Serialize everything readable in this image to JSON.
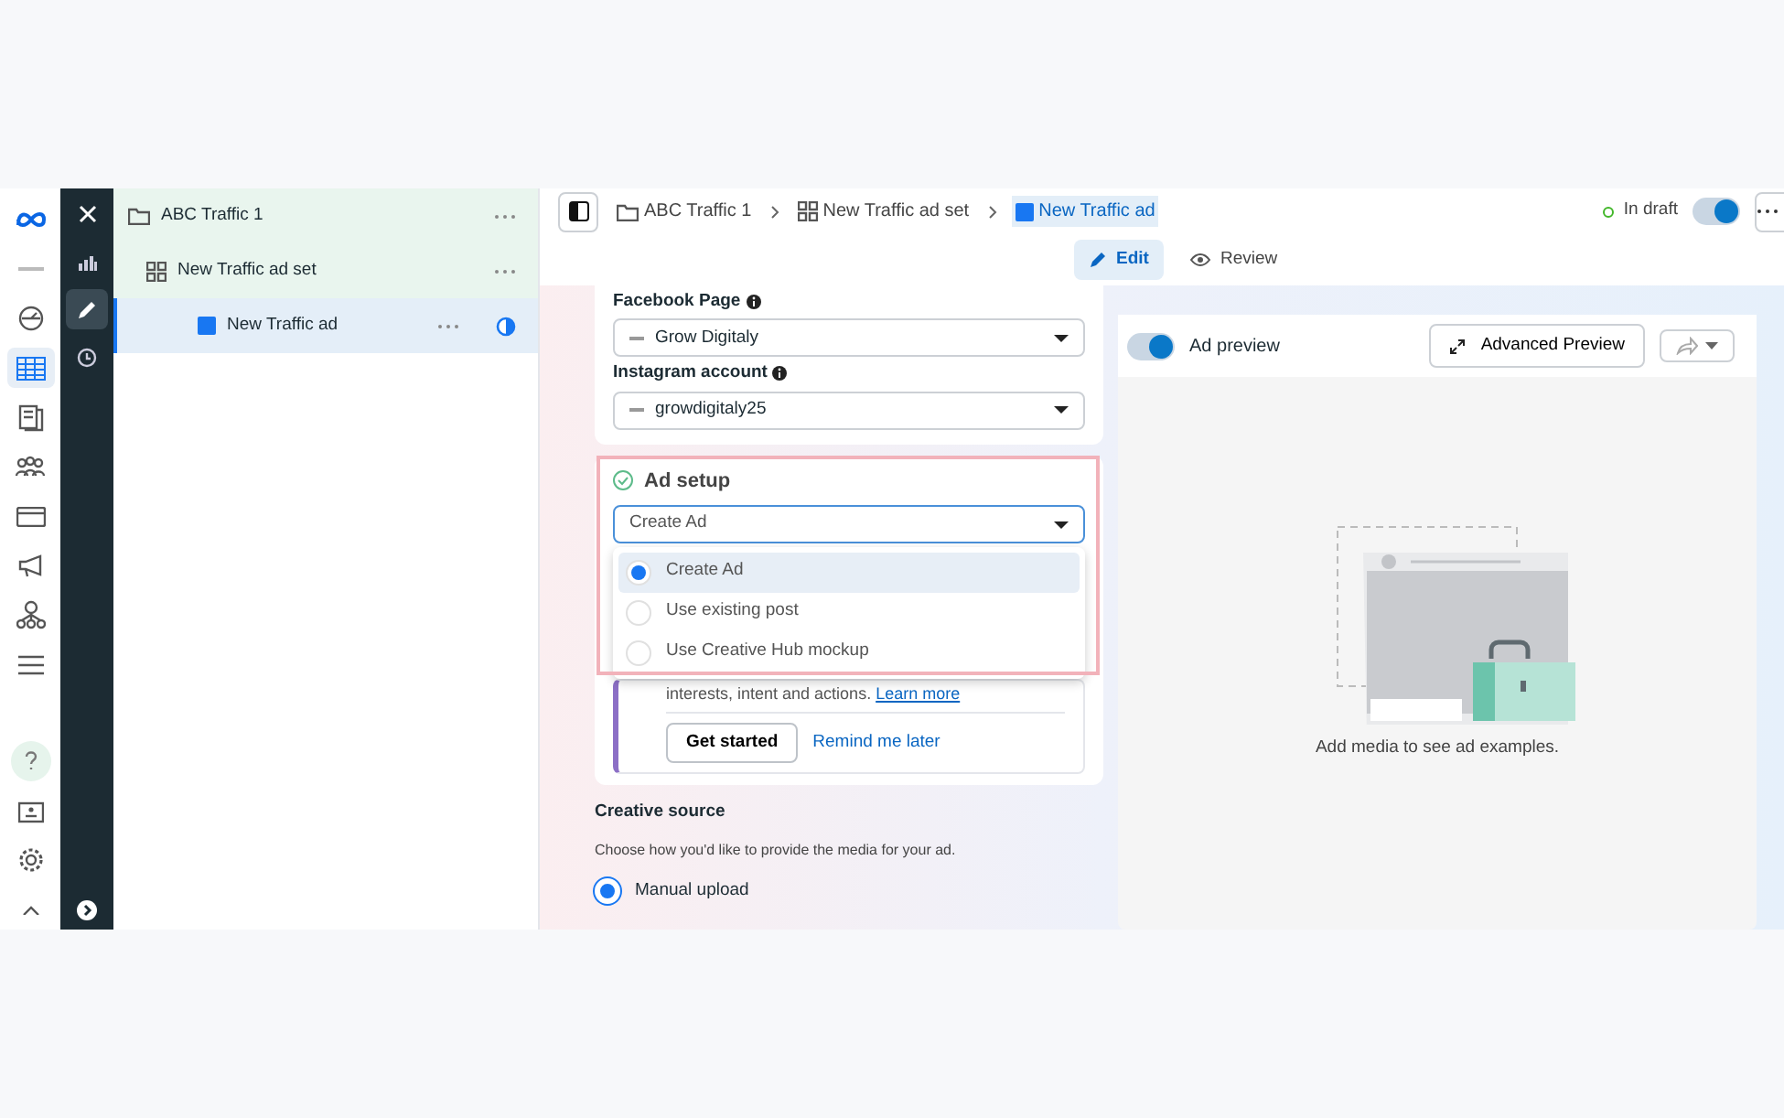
{
  "nav_rail": [
    {
      "kind": "logo",
      "selected": false
    },
    {
      "kind": "account",
      "selected": false
    },
    {
      "kind": "gauge",
      "selected": false
    },
    {
      "kind": "table",
      "selected": true
    },
    {
      "kind": "pages",
      "selected": false
    },
    {
      "kind": "people",
      "selected": false
    },
    {
      "kind": "card",
      "selected": false
    },
    {
      "kind": "megaphone",
      "selected": false
    },
    {
      "kind": "network",
      "selected": false
    },
    {
      "kind": "menu",
      "selected": false
    },
    {
      "kind": "gap"
    },
    {
      "kind": "help",
      "selected": false
    },
    {
      "kind": "contact",
      "selected": false
    },
    {
      "kind": "gear",
      "selected": false
    },
    {
      "kind": "chevron",
      "selected": false
    }
  ],
  "tool_rail": [
    {
      "kind": "close",
      "selected": false
    },
    {
      "kind": "chart",
      "selected": false
    },
    {
      "kind": "pencil",
      "selected": true
    },
    {
      "kind": "clock",
      "selected": false
    },
    {
      "kind": "gap"
    },
    {
      "kind": "expand",
      "selected": false
    }
  ],
  "tree": [
    {
      "kind": "campaign",
      "label": "ABC Traffic 1",
      "selected": false,
      "children": [
        {
          "kind": "adset",
          "label": "New Traffic ad set",
          "selected": false,
          "children": [
            {
              "kind": "ad",
              "label": "New Traffic ad",
              "selected": true
            }
          ]
        }
      ]
    }
  ],
  "breadcrumb": [
    {
      "kind": "campaign",
      "label": "ABC Traffic 1",
      "selected": false
    },
    {
      "kind": "adset",
      "label": "New Traffic ad set",
      "selected": false
    },
    {
      "kind": "ad",
      "label": "New Traffic ad",
      "selected": true
    }
  ],
  "status": {
    "label": "In draft",
    "on": true
  },
  "tabs": [
    {
      "kind": "edit",
      "label": "Edit",
      "selected": true
    },
    {
      "kind": "review",
      "label": "Review",
      "selected": false
    }
  ],
  "identity": {
    "facebook_page": {
      "label": "Facebook Page",
      "value": "Grow Digitaly"
    },
    "instagram_account": {
      "label": "Instagram account",
      "value": "growdigitaly25"
    }
  },
  "ad_setup": {
    "title": "Ad setup",
    "value": "Create Ad",
    "highlighted": true,
    "options": [
      {
        "label": "Create Ad",
        "selected": true
      },
      {
        "label": "Use existing post",
        "selected": false
      },
      {
        "label": "Use Creative Hub mockup",
        "selected": false
      }
    ]
  },
  "notice": {
    "text": "interests, intent and actions.",
    "link": "Learn more",
    "button": "Get started",
    "secondary": "Remind me later"
  },
  "creative_source": {
    "title": "Creative source",
    "description": "Choose how you'd like to provide the media for your ad.",
    "options": [
      {
        "label": "Manual upload",
        "selected": true
      }
    ]
  },
  "preview": {
    "toggle_label": "Ad preview",
    "on": true,
    "advanced_button": "Advanced Preview",
    "empty_text": "Add media to see ad examples."
  }
}
